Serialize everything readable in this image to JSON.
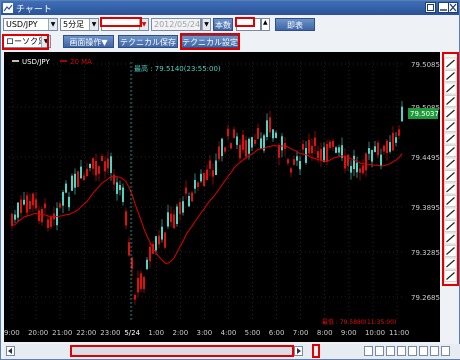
{
  "window": {
    "title": "チャート"
  },
  "toolbar": {
    "symbol": "USD/JPY",
    "interval": "5分足",
    "date_from": "2012/05/24",
    "current_label": "本数",
    "switch_label": "即表",
    "chart_type": "ローソク足",
    "screen_ops": "画面操作▼",
    "technical_save": "テクニカル保存▼",
    "technical_settings": "テクニカル設定"
  },
  "chart_data": {
    "type": "candlestick",
    "legend": [
      {
        "name": "USD/JPY",
        "color": "#ffffff"
      },
      {
        "name": "20 MA",
        "color": "#e00000"
      }
    ],
    "high_annotation": "最高 : 79.5140(23:55:00)",
    "low_annotation": "最低 : 79.5880(11:35:00)",
    "y_ticks": [
      "79.5085",
      "79.5085",
      "79.4495",
      "79.3895",
      "79.3285",
      "79.2685"
    ],
    "current_price": "79.5037",
    "x_ticks": [
      "9:00",
      "20:00",
      "21:00",
      "22:00",
      "23:00",
      "5/24",
      "1:00",
      "2:00",
      "3:00",
      "4:00",
      "5:00",
      "6:00",
      "7:00",
      "8:00",
      "9:00",
      "10:00",
      "11:00"
    ],
    "colors": {
      "up": "#4fd3c4",
      "down": "#e01010",
      "ma": "#e00000",
      "bg": "#000000",
      "grid": "#555555"
    }
  }
}
